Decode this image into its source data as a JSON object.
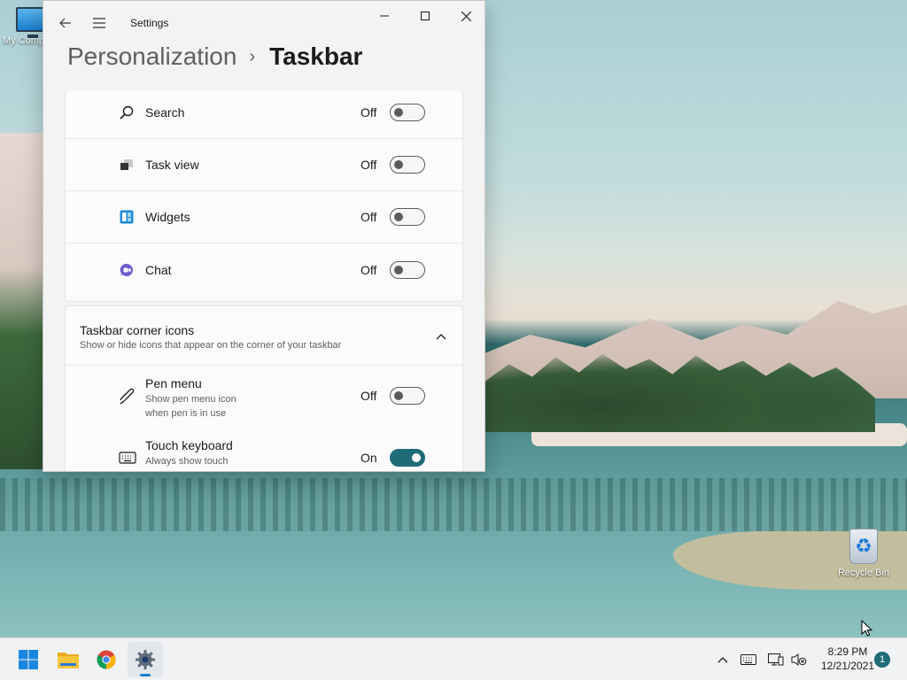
{
  "desktop": {
    "icons": [
      {
        "label": "My Computer"
      },
      {
        "label": "Recycle Bin"
      }
    ]
  },
  "window": {
    "app_title": "Settings",
    "controls": {
      "minimize": "minimize-icon",
      "maximize": "maximize-icon",
      "close": "close-icon"
    },
    "breadcrumb": {
      "parent": "Personalization",
      "separator": "›",
      "current": "Taskbar"
    }
  },
  "taskbar_items": {
    "rows": [
      {
        "label": "Search",
        "state": "Off",
        "on": false,
        "icon": "search-icon"
      },
      {
        "label": "Task view",
        "state": "Off",
        "on": false,
        "icon": "task-view-icon"
      },
      {
        "label": "Widgets",
        "state": "Off",
        "on": false,
        "icon": "widgets-icon"
      },
      {
        "label": "Chat",
        "state": "Off",
        "on": false,
        "icon": "chat-icon"
      }
    ]
  },
  "corner_icons": {
    "title": "Taskbar corner icons",
    "subtitle": "Show or hide icons that appear on the corner of your taskbar",
    "expanded": true,
    "rows": [
      {
        "label": "Pen menu",
        "desc": "Show pen menu icon when pen is in use",
        "state": "Off",
        "on": false,
        "icon": "pen-icon"
      },
      {
        "label": "Touch keyboard",
        "desc": "Always show touch keyboard icon",
        "state": "On",
        "on": true,
        "icon": "keyboard-icon"
      }
    ]
  },
  "taskbar": {
    "apps": [
      "start-icon",
      "file-explorer-icon",
      "chrome-icon",
      "settings-icon"
    ],
    "active_app": "settings-icon",
    "tray": [
      "chevron-up-icon",
      "keyboard-icon",
      "network-icon",
      "volume-muted-icon"
    ],
    "time": "8:29 PM",
    "date": "12/21/2021",
    "notification_count": "1"
  },
  "colors": {
    "accent": "#1f6b78",
    "window_bg": "#f3f3f3",
    "card_bg": "#fbfbfb",
    "taskbar_bg": "#f0f2f4"
  }
}
